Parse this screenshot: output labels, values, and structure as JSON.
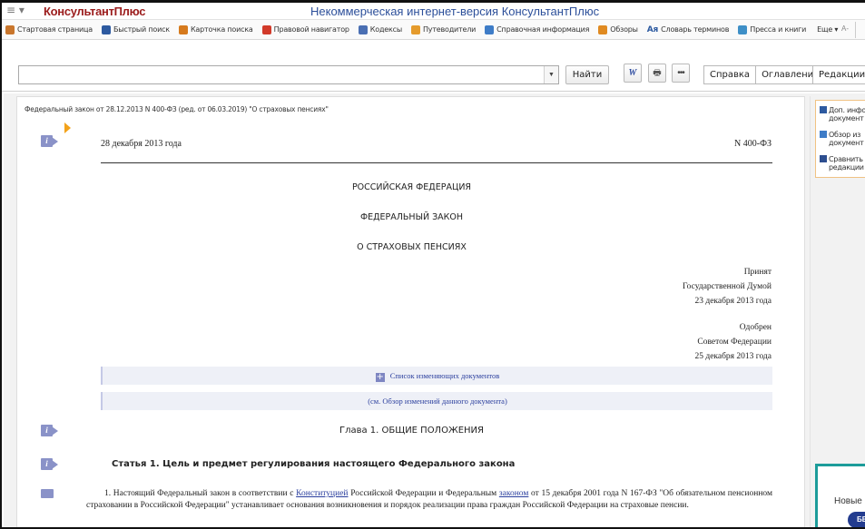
{
  "titlebar": {
    "menu_glyph": "≡ ▾",
    "brand": "КонсультантПлюс",
    "title": "Некоммерческая интернет-версия КонсультантПлюс"
  },
  "menubar": {
    "items": [
      {
        "label": "Стартовая страница",
        "icon": "home-icon",
        "color": "#c9762c"
      },
      {
        "label": "Быстрый поиск",
        "icon": "search-icon",
        "color": "#2d5aa0"
      },
      {
        "label": "Карточка поиска",
        "icon": "card-search-icon",
        "color": "#d67a1d"
      },
      {
        "label": "Правовой навигатор",
        "icon": "navigator-icon",
        "color": "#d23a2a"
      },
      {
        "label": "Кодексы",
        "icon": "codes-icon",
        "color": "#4a6fb3"
      },
      {
        "label": "Путеводители",
        "icon": "guides-icon",
        "color": "#e59b2c"
      },
      {
        "label": "Справочная информация",
        "icon": "reference-icon",
        "color": "#3e7cc7"
      },
      {
        "label": "Обзоры",
        "icon": "reviews-icon",
        "color": "#e08a21"
      },
      {
        "label": "Словарь терминов",
        "icon": "dictionary-icon",
        "color": "#2d5aa0",
        "prefix": "Ая"
      },
      {
        "label": "Пресса и книги",
        "icon": "press-icon",
        "color": "#3e8fc7"
      },
      {
        "label": "Еще ▾",
        "icon": "",
        "color": ""
      }
    ],
    "minimize_label": "A-"
  },
  "toolbar": {
    "search_value": "",
    "find_label": "Найти",
    "word_label": "W",
    "print_glyph": "🖶",
    "more_glyph": "•••",
    "tabs": [
      "Справка",
      "Оглавление"
    ],
    "editions_label": "Редакции"
  },
  "document": {
    "header": "Федеральный закон от 28.12.2013 N 400-ФЗ (ред. от 06.03.2019) \"О страховых пенсиях\"",
    "date": "28 декабря 2013 года",
    "number": "N 400-ФЗ",
    "country": "РОССИЙСКАЯ ФЕДЕРАЦИЯ",
    "law_type": "ФЕДЕРАЛЬНЫЙ ЗАКОН",
    "law_title": "О СТРАХОВЫХ ПЕНСИЯХ",
    "adopted": [
      "Принят",
      "Государственной Думой",
      "23 декабря 2013 года"
    ],
    "approved": [
      "Одобрен",
      "Советом Федерации",
      "25 декабря 2013 года"
    ],
    "amend_list": "Список изменяющих документов",
    "amend_review": "(см. Обзор изменений данного документа)",
    "chapter": "Глава 1. ОБЩИЕ ПОЛОЖЕНИЯ",
    "article": "Статья 1. Цель и предмет регулирования настоящего Федерального закона",
    "para_pre": "1. Настоящий Федеральный закон в соответствии с ",
    "para_link1": "Конституцией",
    "para_mid": " Российской Федерации и Федеральным ",
    "para_link2": "законом",
    "para_post": " от 15 декабря 2001 года N 167-ФЗ \"Об обязательном пенсионном страховании в Российской Федерации\" устанавливает основания возникновения и порядок реализации права граждан Российской Федерации на страховые пенсии."
  },
  "sidepanel": {
    "items": [
      {
        "line1": "Доп. инфо",
        "line2": "документ",
        "icon": "info-icon",
        "color": "#2d5aa0"
      },
      {
        "line1": "Обзор из",
        "line2": "документ",
        "icon": "review-icon",
        "color": "#3e7cc7"
      },
      {
        "line1": "Сравнить",
        "line2": "редакции",
        "icon": "compare-icon",
        "color": "#2d4e8f"
      }
    ]
  },
  "promo": {
    "text": "Новые",
    "button": "БЕС"
  }
}
